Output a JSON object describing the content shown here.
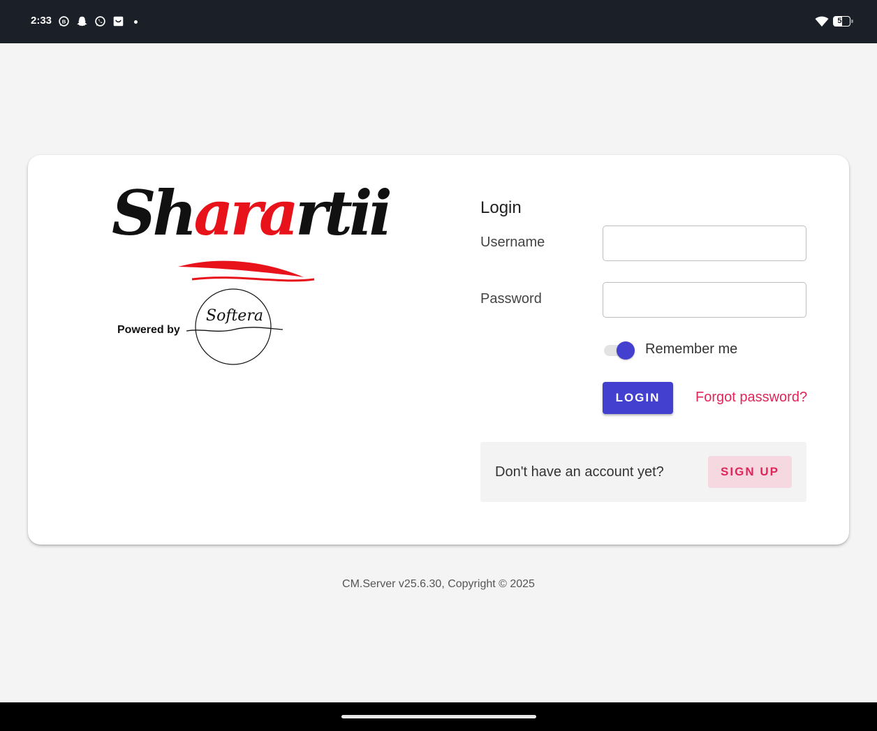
{
  "status_bar": {
    "time": "2:33",
    "notification_icons": [
      "whatsapp-business-icon",
      "snapchat-icon",
      "whatsapp-icon",
      "shopping-bag-icon"
    ],
    "battery_level": "53"
  },
  "brand": {
    "name_parts": [
      "Sh",
      "ara",
      "rtii"
    ],
    "powered_by": "Powered by",
    "partner": "Softera"
  },
  "login": {
    "title": "Login",
    "username_label": "Username",
    "username_value": "",
    "password_label": "Password",
    "password_value": "",
    "remember_label": "Remember me",
    "remember_enabled": true,
    "login_button": "LOGIN",
    "forgot_link": "Forgot password?"
  },
  "signup": {
    "prompt": "Don't have an account yet?",
    "button": "SIGN UP"
  },
  "footer": {
    "text": "CM.Server v25.6.30, Copyright © 2025"
  },
  "colors": {
    "primary": "#4340cf",
    "accent": "#e0255a",
    "status_bar": "#1b1f27",
    "background": "#f4f4f4"
  }
}
